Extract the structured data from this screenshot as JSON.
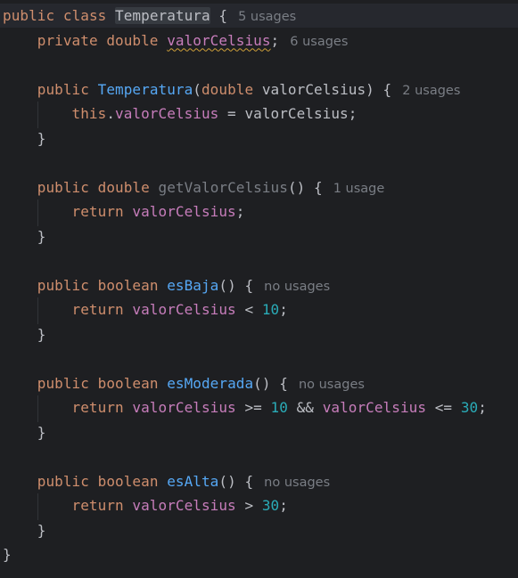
{
  "colors": {
    "background": "#1e1f22",
    "keyword": "#cf8e6d",
    "field": "#c77dbb",
    "method": "#56a8f5",
    "unused_method": "#7a7e85",
    "number": "#2aacb8",
    "plain": "#bcbec4",
    "hint": "#7a7e85"
  },
  "code": {
    "class_decl": {
      "kw_public": "public",
      "kw_class": "class",
      "class_name": "Temperatura",
      "brace": " {",
      "hint": "5 usages"
    },
    "field_decl": {
      "kw_private": "private",
      "type": "double",
      "name": "valorCelsius",
      "semi": ";",
      "hint": "6 usages"
    },
    "constructor": {
      "kw_public": "public",
      "name": "Temperatura",
      "open_paren": "(",
      "param_type": "double",
      "param_name": " valorCelsius) {",
      "hint": "2 usages",
      "body_this": "this",
      "body_dot": ".",
      "body_field": "valorCelsius",
      "body_rest": " = valorCelsius;",
      "close": "}"
    },
    "getter": {
      "kw_public": "public",
      "type": "double",
      "name": "getValorCelsius",
      "sig_rest": "() {",
      "hint": "1 usage",
      "kw_return": "return",
      "field": "valorCelsius",
      "semi": ";",
      "close": "}"
    },
    "es_baja": {
      "kw_public": "public",
      "type": "boolean",
      "name": "esBaja",
      "sig_rest": "() {",
      "hint": "no usages",
      "kw_return": "return",
      "field": "valorCelsius",
      "op": " < ",
      "num": "10",
      "semi": ";",
      "close": "}"
    },
    "es_moderada": {
      "kw_public": "public",
      "type": "boolean",
      "name": "esModerada",
      "sig_rest": "() {",
      "hint": "no usages",
      "kw_return": "return",
      "field1": "valorCelsius",
      "op1": " >= ",
      "num1": "10",
      "op2": " && ",
      "field2": "valorCelsius",
      "op3": " <= ",
      "num2": "30",
      "semi": ";",
      "close": "}"
    },
    "es_alta": {
      "kw_public": "public",
      "type": "boolean",
      "name": "esAlta",
      "sig_rest": "() {",
      "hint": "no usages",
      "kw_return": "return",
      "field": "valorCelsius",
      "op": " > ",
      "num": "30",
      "semi": ";",
      "close": "}"
    },
    "class_close": "}"
  }
}
